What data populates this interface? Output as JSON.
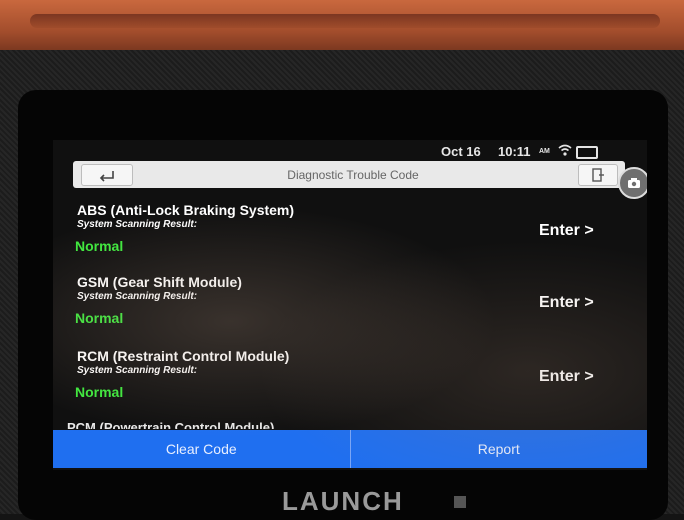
{
  "status": {
    "date": "Oct 16",
    "time": "10:11",
    "ampm": "AM"
  },
  "header": {
    "title": "Diagnostic Trouble Code"
  },
  "systems": [
    {
      "name": "ABS (Anti-Lock Braking System)",
      "label": "System Scanning Result:",
      "result": "Normal",
      "action": "Enter >"
    },
    {
      "name": "GSM (Gear Shift Module)",
      "label": "System Scanning Result:",
      "result": "Normal",
      "action": "Enter >"
    },
    {
      "name": "RCM (Restraint Control Module)",
      "label": "System Scanning Result:",
      "result": "Normal",
      "action": "Enter >"
    }
  ],
  "partial_item": "PCM (Powertrain Control Module)",
  "footer": {
    "clear_label": "Clear Code",
    "report_label": "Report"
  },
  "device": {
    "brand": "LAUNCH"
  },
  "icons": {
    "back": "back-arrow-icon",
    "exit": "exit-door-icon",
    "camera": "camera-icon",
    "wifi": "wifi-icon",
    "battery": "battery-icon"
  },
  "colors": {
    "accent": "#1f6ff0",
    "result_ok": "#3dea3d"
  }
}
